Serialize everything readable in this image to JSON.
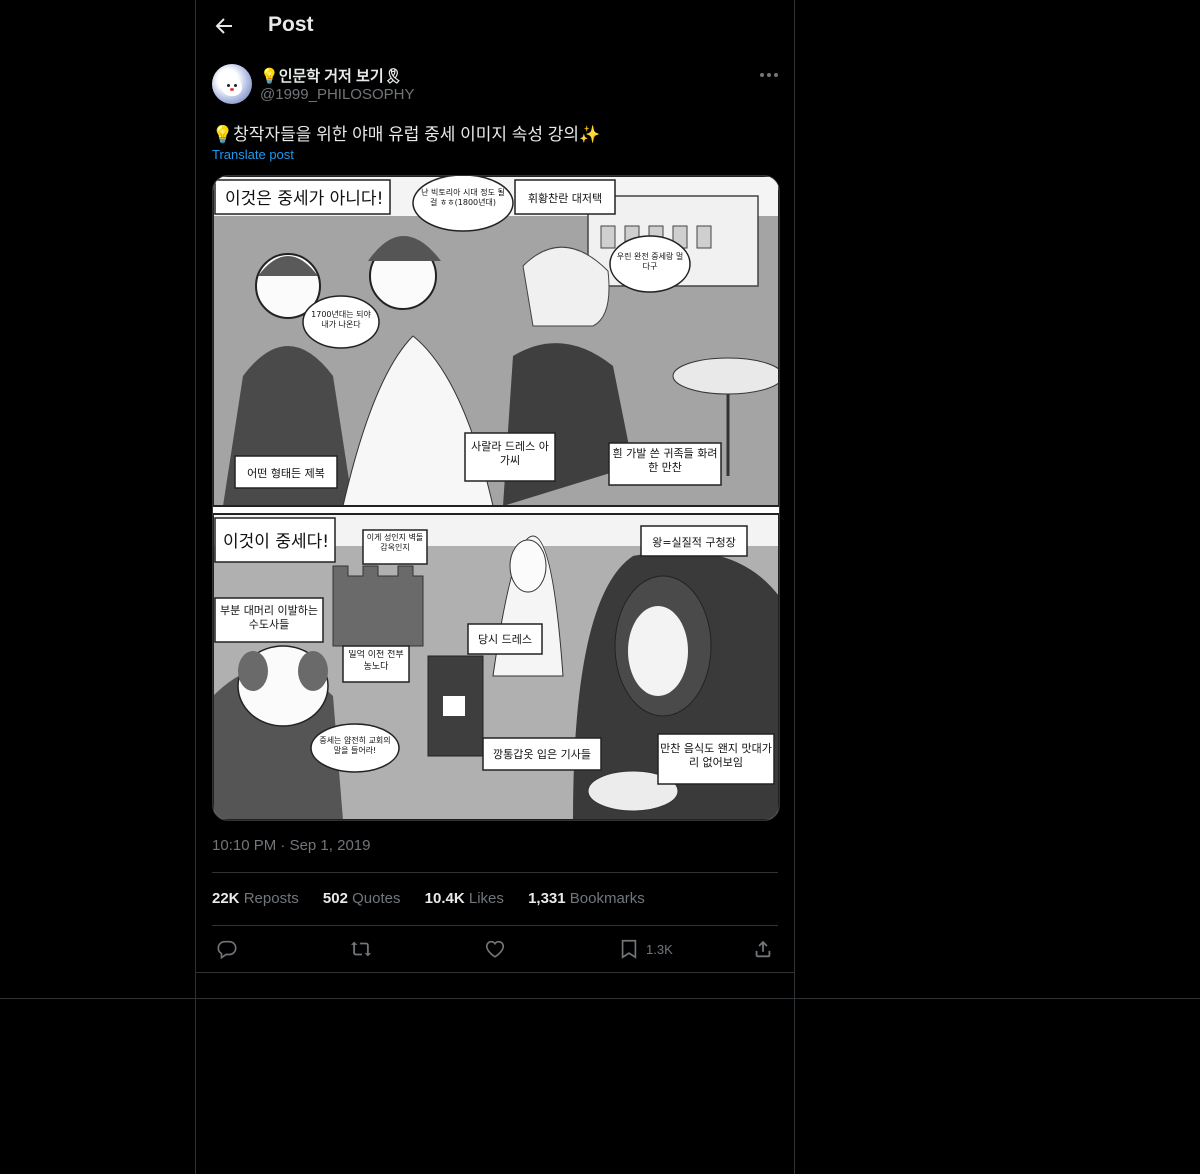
{
  "header": {
    "title": "Post"
  },
  "author": {
    "name_prefix_emoji": "💡",
    "name": "인문학 거저 보기",
    "name_suffix_emoji": "🎗",
    "handle": "@1999_PHILOSOPHY"
  },
  "tweet": {
    "text": "💡창작자들을 위한 야매 유럽 중세 이미지 속성 강의✨",
    "translate_label": "Translate post",
    "time": "10:10 PM",
    "separator": "·",
    "date": "Sep 1, 2019"
  },
  "media": {
    "panel1": {
      "caption": "이것은 중세가 아니다!",
      "bubble_victoria": "난 빅토리아 시대 정도 될걸 ㅎㅎ(1800년대)",
      "label_mansion": "휘황찬란 대저택",
      "bubble_different": "우린 완전 중세랑 멀다구",
      "bubble_1700": "1700년대는 되야 내가 나온다",
      "label_uniform": "어떤 형태든 제복",
      "label_dress": "사랄라 드레스 아가씨",
      "label_wig": "흰 가발 쓴 귀족들 화려한 만찬"
    },
    "panel2": {
      "caption": "이것이 중세다!",
      "bubble_castle": "이게 성인지 벽돌감옥인지",
      "label_king": "왕=실질적 구청장",
      "label_monks": "부분 대머리 이발하는 수도사들",
      "label_farmers": "일억 이천 전부 농노다",
      "label_period_dress": "당시 드레스",
      "bubble_church": "중세는 얌전히 교회의 말을 들어라!",
      "label_knights": "깡통갑옷 입은 기사들",
      "label_feast": "만찬 음식도 왠지 맛대가리 없어보임"
    }
  },
  "stats": {
    "reposts_count": "22K",
    "reposts_label": "Reposts",
    "quotes_count": "502",
    "quotes_label": "Quotes",
    "likes_count": "10.4K",
    "likes_label": "Likes",
    "bookmarks_count": "1,331",
    "bookmarks_label": "Bookmarks"
  },
  "actions": {
    "bookmark_count": "1.3K"
  },
  "icons": [
    "back-arrow-icon",
    "more-icon",
    "reply-icon",
    "repost-icon",
    "like-icon",
    "bookmark-icon",
    "share-icon"
  ]
}
